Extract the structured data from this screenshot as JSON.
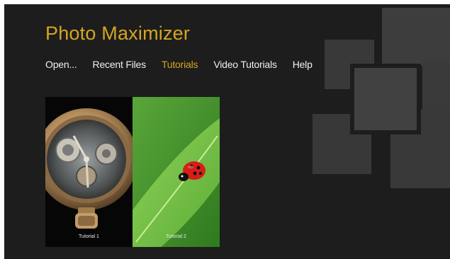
{
  "app": {
    "title": "Photo Maximizer"
  },
  "nav": {
    "items": [
      {
        "label": "Open..."
      },
      {
        "label": "Recent Files"
      },
      {
        "label": "Tutorials",
        "active": true
      },
      {
        "label": "Video Tutorials"
      },
      {
        "label": "Help"
      }
    ]
  },
  "tutorials": [
    {
      "label": "Tutorial 1",
      "image": "pocket-watch"
    },
    {
      "label": "Tutorial 2",
      "image": "ladybug-on-leaf"
    }
  ],
  "colors": {
    "background": "#1d1d1d",
    "accent": "#d6a520",
    "nav_text": "#f0f0f0",
    "deco_square": "#3a3a3a"
  }
}
